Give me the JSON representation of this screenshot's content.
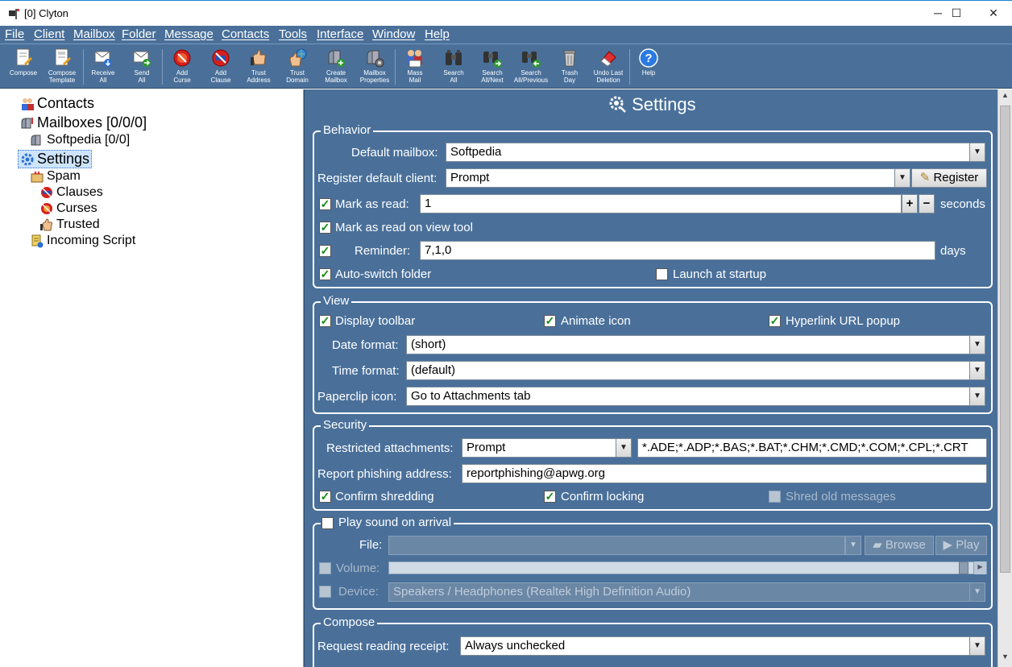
{
  "window": {
    "title": "[0] Clyton",
    "minimize": "─",
    "maximize": "☐",
    "close": "✕"
  },
  "menu": [
    "File",
    "Client",
    "Mailbox",
    "Folder",
    "Message",
    "Contacts",
    "Tools",
    "Interface",
    "Window",
    "Help"
  ],
  "toolbar": [
    {
      "l1": "Compose",
      "l2": "",
      "icon": "compose-icon"
    },
    {
      "l1": "Compose",
      "l2": "Template",
      "icon": "compose-template-icon"
    },
    {
      "l1": "Receive",
      "l2": "All",
      "icon": "receive-all-icon"
    },
    {
      "l1": "Send",
      "l2": "All",
      "icon": "send-all-icon"
    },
    {
      "l1": "Add",
      "l2": "Curse",
      "icon": "add-curse-icon"
    },
    {
      "l1": "Add",
      "l2": "Clause",
      "icon": "add-clause-icon"
    },
    {
      "l1": "Trust",
      "l2": "Address",
      "icon": "trust-address-icon"
    },
    {
      "l1": "Trust",
      "l2": "Domain",
      "icon": "trust-domain-icon"
    },
    {
      "l1": "Create",
      "l2": "Mailbox",
      "icon": "create-mailbox-icon"
    },
    {
      "l1": "Mailbox",
      "l2": "Properties",
      "icon": "mailbox-properties-icon"
    },
    {
      "l1": "Mass",
      "l2": "Mail",
      "icon": "mass-mail-icon"
    },
    {
      "l1": "Search",
      "l2": "All",
      "icon": "search-all-icon"
    },
    {
      "l1": "Search",
      "l2": "All/Next",
      "icon": "search-next-icon"
    },
    {
      "l1": "Search",
      "l2": "All/Previous",
      "icon": "search-previous-icon"
    },
    {
      "l1": "Trash",
      "l2": "Day",
      "icon": "trash-day-icon"
    },
    {
      "l1": "Undo Last",
      "l2": "Deletion",
      "icon": "undo-deletion-icon"
    },
    {
      "l1": "Help",
      "l2": "",
      "icon": "help-icon"
    }
  ],
  "tree": {
    "contacts": "Contacts",
    "mailboxes": "Mailboxes [0/0/0]",
    "softpedia": "Softpedia [0/0]",
    "settings": "Settings",
    "spam": "Spam",
    "clauses": "Clauses",
    "curses": "Curses",
    "trusted": "Trusted",
    "incoming": "Incoming Script"
  },
  "settings": {
    "title": "Settings",
    "behavior": {
      "legend": "Behavior",
      "default_mailbox_label": "Default mailbox:",
      "default_mailbox_value": "Softpedia",
      "register_client_label": "Register default client:",
      "register_client_value": "Prompt",
      "register_button": "Register",
      "mark_as_read_label": "Mark as read:",
      "mark_as_read_value": "1",
      "plus": "+",
      "minus": "−",
      "seconds": "seconds",
      "mark_view_tool": "Mark as read on view tool",
      "reminder_label": "Reminder:",
      "reminder_value": "7,1,0",
      "days": "days",
      "auto_switch": "Auto-switch folder",
      "launch_startup": "Launch at startup"
    },
    "view": {
      "legend": "View",
      "display_toolbar": "Display toolbar",
      "animate_icon": "Animate icon",
      "hyperlink_popup": "Hyperlink URL popup",
      "date_format_label": "Date format:",
      "date_format_value": "(short)",
      "time_format_label": "Time format:",
      "time_format_value": "(default)",
      "paperclip_label": "Paperclip icon:",
      "paperclip_value": "Go to Attachments tab"
    },
    "security": {
      "legend": "Security",
      "restricted_label": "Restricted attachments:",
      "restricted_value": "Prompt",
      "restricted_list": "*.ADE;*.ADP;*.BAS;*.BAT;*.CHM;*.CMD;*.COM;*.CPL;*.CRT",
      "phishing_label": "Report phishing address:",
      "phishing_value": "reportphishing@apwg.org",
      "confirm_shredding": "Confirm shredding",
      "confirm_locking": "Confirm locking",
      "shred_old": "Shred old messages"
    },
    "sound": {
      "legend": "Play sound on arrival",
      "file_label": "File:",
      "file_value": "",
      "browse": "Browse",
      "play": "Play",
      "volume_label": "Volume:",
      "device_label": "Device:",
      "device_value": "Speakers / Headphones (Realtek High Definition Audio)"
    },
    "compose": {
      "legend": "Compose",
      "reading_receipt_label": "Request reading receipt:",
      "reading_receipt_value": "Always unchecked"
    },
    "check": "✓",
    "dd": "▼"
  }
}
